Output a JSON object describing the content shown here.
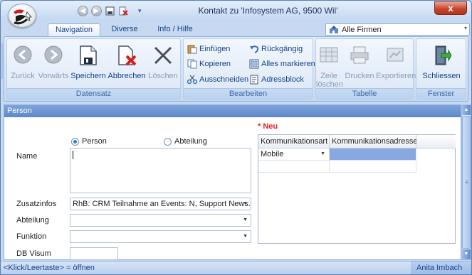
{
  "window": {
    "title": "Kontakt zu 'Infosystem AG, 9500 Wil'",
    "close_glyph": "x"
  },
  "qat": {
    "back_glyph": "◀",
    "forward_glyph": "▶",
    "dropdown_glyph": "▾"
  },
  "tabs": [
    {
      "label": "Navigation",
      "active": true
    },
    {
      "label": "Diverse",
      "active": false
    },
    {
      "label": "Info / Hilfe",
      "active": false
    }
  ],
  "company_selector": {
    "value": "Alle Firmen"
  },
  "ribbon": {
    "groups": {
      "datensatz": "Datensatz",
      "bearbeiten": "Bearbeiten",
      "tabelle": "Tabelle",
      "fenster": "Fenster"
    },
    "buttons": {
      "zurueck": "Zurück",
      "vorwaerts": "Vorwärts",
      "speichern": "Speichern",
      "abbrechen": "Abbrechen",
      "loeschen": "Löschen",
      "einfuegen": "Einfügen",
      "kopieren": "Kopieren",
      "ausschneiden": "Ausschneiden",
      "rueckgaengig": "Rückgängig",
      "alles_markieren": "Alles markieren",
      "adressblock": "Adressblock",
      "zeile_loeschen_1": "Zeile",
      "zeile_loeschen_2": "löschen",
      "drucken": "Drucken",
      "exportieren": "Exportieren",
      "schliessen": "Schliessen"
    }
  },
  "form": {
    "section_title": "Person",
    "new_marker": "* Neu",
    "radio_person": "Person",
    "radio_abteilung": "Abteilung",
    "radio_selected": "Person",
    "labels": {
      "name": "Name",
      "zusatzinfos": "Zusatzinfos",
      "abteilung": "Abteilung",
      "funktion": "Funktion",
      "db_visum": "DB Visum"
    },
    "values": {
      "name": "",
      "zusatzinfos": "RhB: CRM Teilnahme an Events: N, Support News...",
      "abteilung": "",
      "funktion": "",
      "db_visum": ""
    }
  },
  "grid": {
    "headers": [
      "Kommunikationsart",
      "Kommunikationsadresse"
    ],
    "rows": [
      {
        "art": "Mobile",
        "adresse": ""
      }
    ]
  },
  "statusbar": {
    "hint": "<Klick/Leertaste> = öffnen",
    "user": "Anita Imbach"
  },
  "colors": {
    "accent": "#15428b",
    "section_header": "#5d87c8",
    "selected_cell": "#87a8e0",
    "new_marker": "#dd2222",
    "close_button": "#c8472f"
  },
  "icons": {
    "app": "app-logo-icon",
    "save": "save-icon",
    "cancel": "cancel-icon",
    "delete": "delete-icon",
    "back": "back-arrow-icon",
    "forward": "forward-arrow-icon",
    "paste": "paste-icon",
    "copy": "copy-icon",
    "cut": "scissors-icon",
    "undo": "undo-icon",
    "select_all": "select-all-icon",
    "address_block": "address-block-icon",
    "delete_row": "delete-row-icon",
    "print": "print-icon",
    "export": "export-icon",
    "close_window": "exit-door-icon",
    "company": "company-icon"
  }
}
